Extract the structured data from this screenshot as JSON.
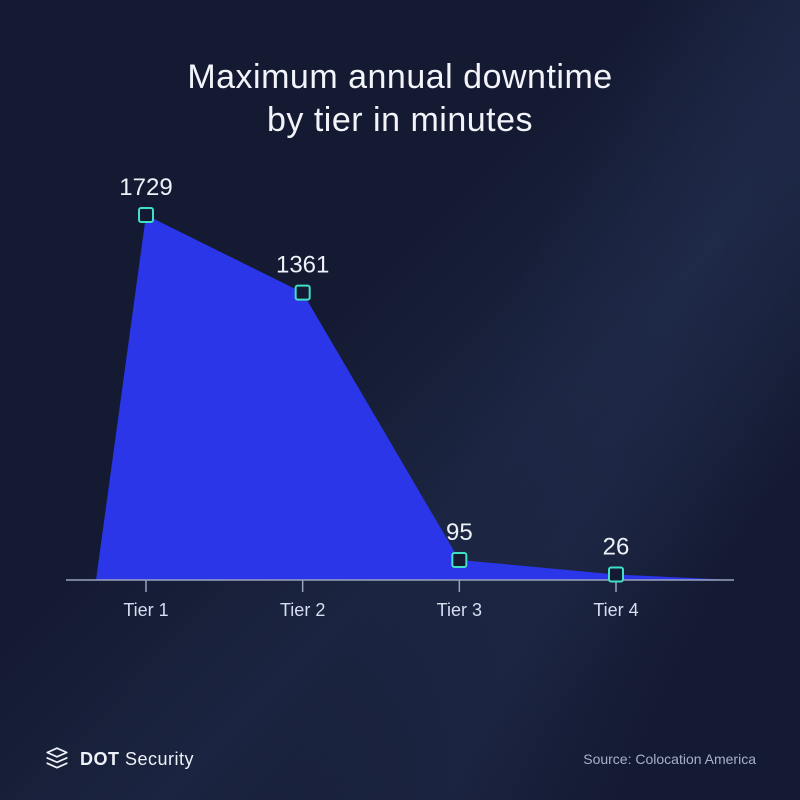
{
  "title_line1": "Maximum annual downtime",
  "title_line2": "by tier in minutes",
  "brand": {
    "part1": "DOT",
    "part2": "Security"
  },
  "source_label": "Source: Colocation America",
  "colors": {
    "background": "#141a32",
    "area": "#2a36e8",
    "axis": "#9aa3c0",
    "marker_stroke": "#3fe0c5",
    "text": "#eef1f8"
  },
  "chart_data": {
    "type": "area",
    "title": "Maximum annual downtime by tier in minutes",
    "xlabel": "",
    "ylabel": "",
    "categories": [
      "Tier 1",
      "Tier 2",
      "Tier 3",
      "Tier 4"
    ],
    "values": [
      1729,
      1361,
      95,
      26
    ],
    "ylim": [
      0,
      1800
    ],
    "legend": false,
    "grid": false
  }
}
